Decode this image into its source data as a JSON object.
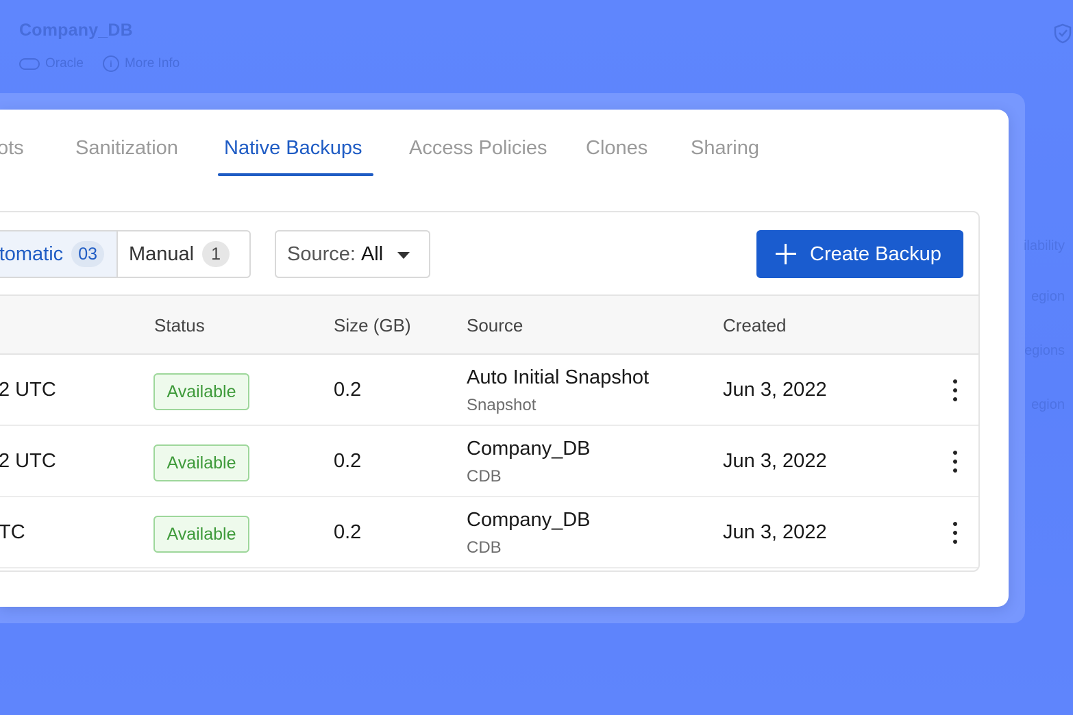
{
  "background": {
    "title": "Company_DB",
    "meta": [
      {
        "icon": "database-pill-icon",
        "label": "Oracle"
      },
      {
        "icon": "info-icon",
        "label": "More Info"
      }
    ],
    "side_items": [
      "ilability",
      "egion",
      "egions",
      "egion"
    ]
  },
  "tabs": [
    {
      "label": "ots",
      "active": false
    },
    {
      "label": "Sanitization",
      "active": false
    },
    {
      "label": "Native Backups",
      "active": true
    },
    {
      "label": "Access Policies",
      "active": false
    },
    {
      "label": "Clones",
      "active": false
    },
    {
      "label": "Sharing",
      "active": false
    }
  ],
  "toolbar": {
    "automatic_label": "utomatic",
    "automatic_count": "03",
    "manual_label": "Manual",
    "manual_count": "1",
    "source_label": "Source:",
    "source_value": "All",
    "create_label": "Create Backup"
  },
  "table": {
    "headers": {
      "status": "Status",
      "size": "Size (GB)",
      "source": "Source",
      "created": "Created"
    },
    "rows": [
      {
        "name": "2 UTC",
        "status": "Available",
        "size": "0.2",
        "source": "Auto Initial Snapshot",
        "source_type": "Snapshot",
        "created": "Jun 3, 2022"
      },
      {
        "name": "2 UTC",
        "status": "Available",
        "size": "0.2",
        "source": "Company_DB",
        "source_type": "CDB",
        "created": "Jun 3, 2022"
      },
      {
        "name": "TC",
        "status": "Available",
        "size": "0.2",
        "source": "Company_DB",
        "source_type": "CDB",
        "created": "Jun 3, 2022"
      }
    ]
  },
  "colors": {
    "accent": "#1a5ccf",
    "active_tab": "#1f5cc4",
    "status_available": "#3e9a3a",
    "page_background": "#5b82fb"
  }
}
